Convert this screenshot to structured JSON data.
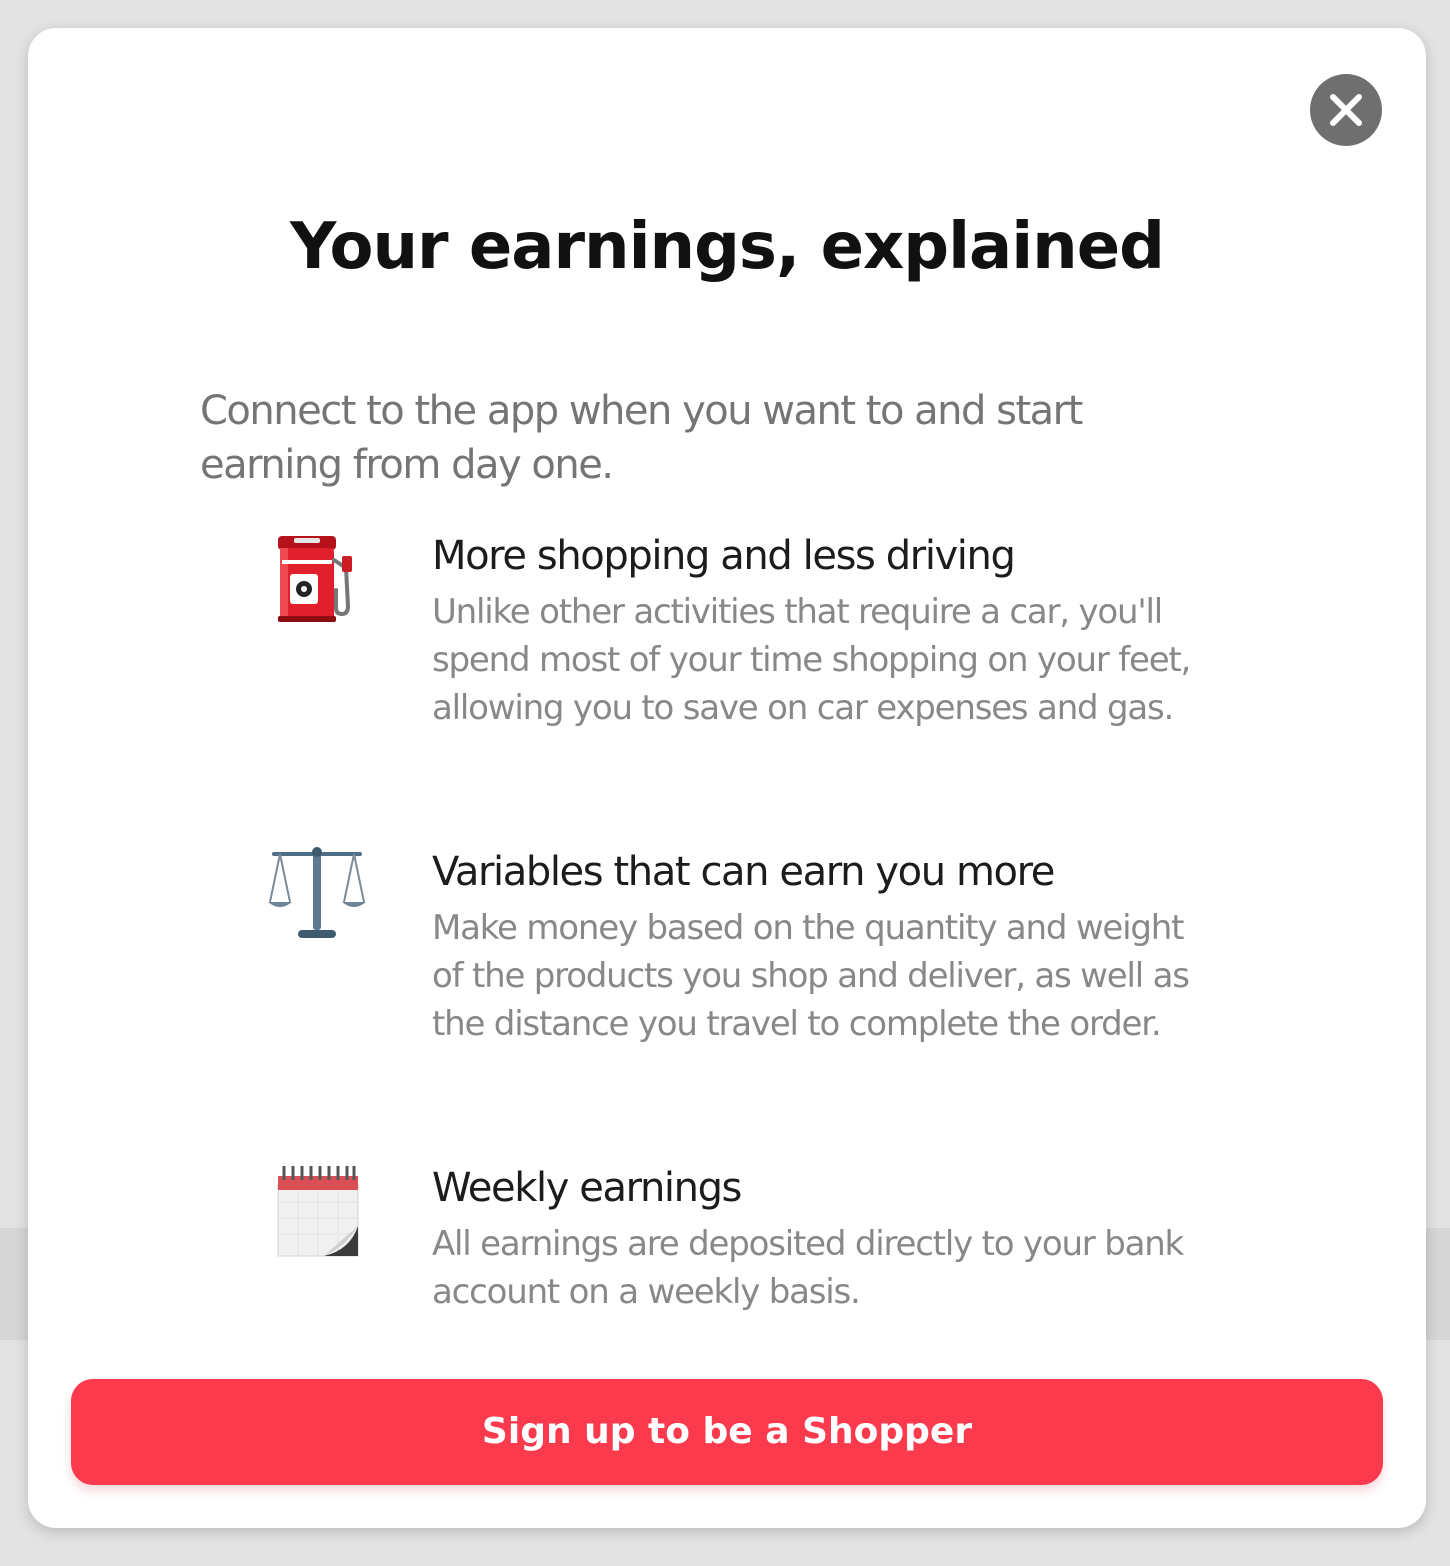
{
  "modal": {
    "title": "Your earnings, explained",
    "intro": "Connect to the app when you want to and start earning from day one.",
    "close_icon": "close-icon",
    "features": [
      {
        "icon": "fuel-pump-icon",
        "title": "More shopping and less driving",
        "description": "Unlike other activities that require a car, you'll spend most of your time shopping on your feet, allowing you to save on car expenses and gas."
      },
      {
        "icon": "balance-scale-icon",
        "title": "Variables that can earn you more",
        "description": "Make money based on the quantity and weight of the products you shop and deliver, as well as the distance you travel to complete the order."
      },
      {
        "icon": "calendar-icon",
        "title": "Weekly earnings",
        "description": "All earnings are deposited directly to your bank account on a weekly basis."
      }
    ],
    "cta_label": "Sign up to be a Shopper"
  },
  "colors": {
    "accent": "#fb3a4d",
    "close_button": "#6f6f6f",
    "title_text": "#111111",
    "body_text": "#888888"
  }
}
